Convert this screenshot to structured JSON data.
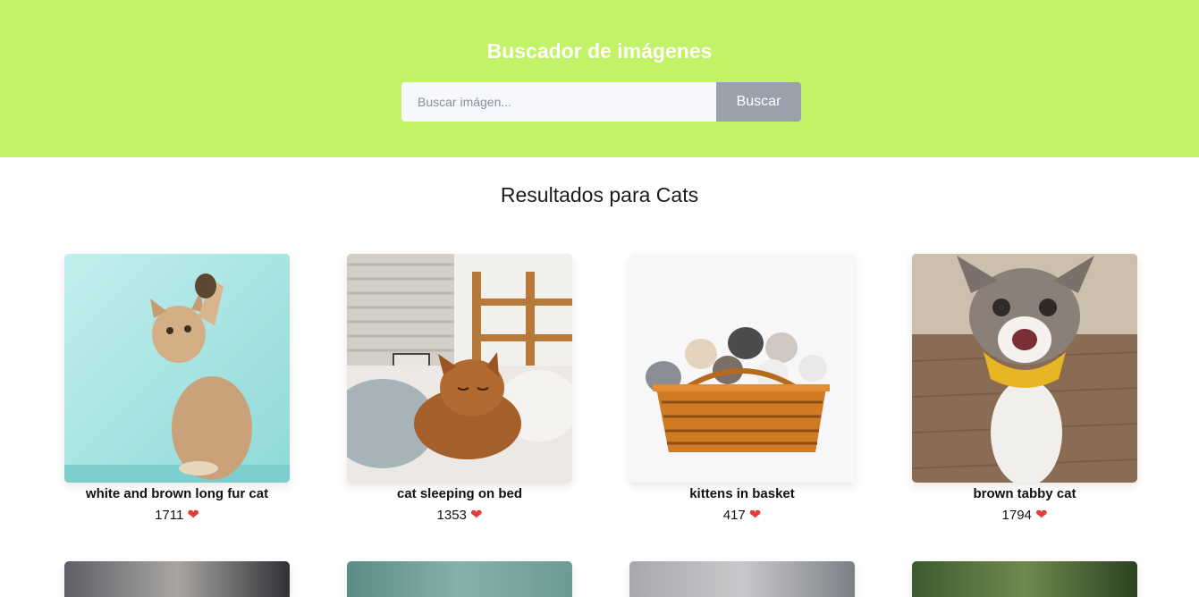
{
  "header": {
    "title": "Buscador de imágenes",
    "search_placeholder": "Buscar imágen...",
    "search_button": "Buscar",
    "background": "#c2f266"
  },
  "results": {
    "title": "Resultados para Cats",
    "cards": [
      {
        "caption": "white and brown long fur cat",
        "likes": "1711"
      },
      {
        "caption": "cat sleeping on bed",
        "likes": "1353"
      },
      {
        "caption": "kittens in basket",
        "likes": "417"
      },
      {
        "caption": "brown tabby cat",
        "likes": "1794"
      }
    ]
  },
  "icons": {
    "like": "heart-icon"
  },
  "heart_glyph": "❤",
  "accent_colors": {
    "heart": "#e53b3b",
    "button": "#9aa1ac"
  }
}
